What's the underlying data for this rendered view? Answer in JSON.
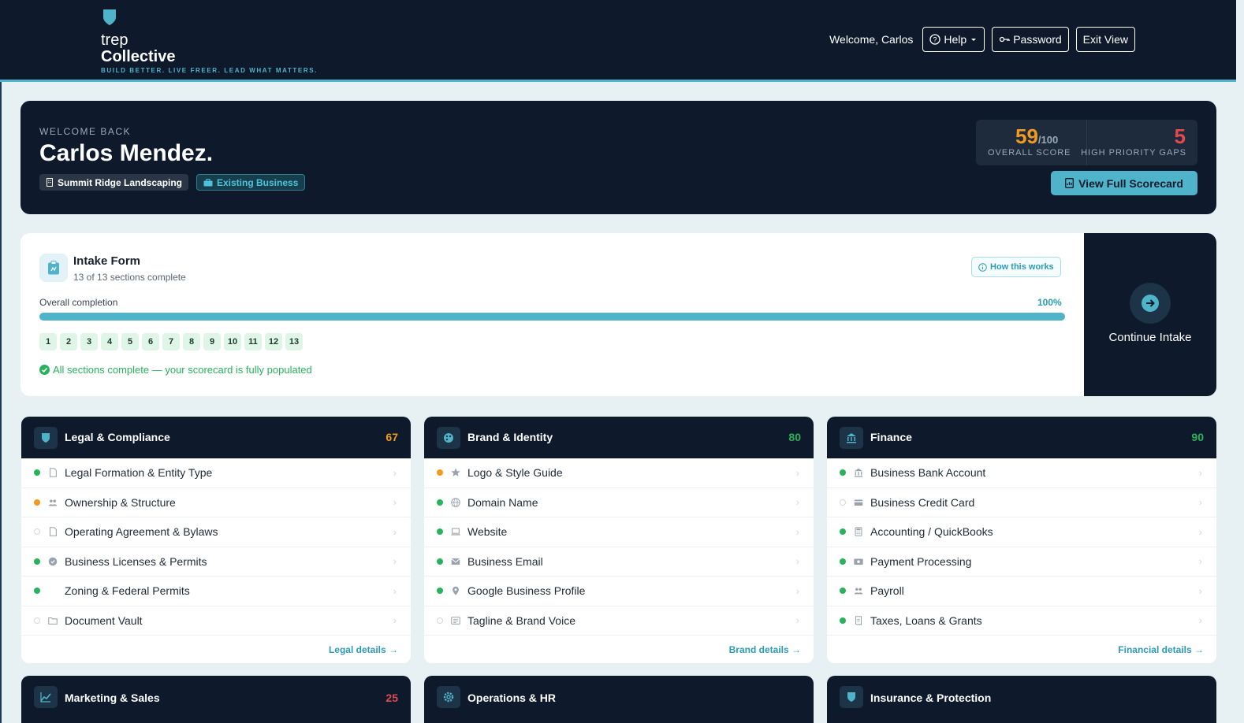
{
  "brand": {
    "line1": "trep",
    "line2": "Collective",
    "tagline": "BUILD BETTER. LIVE FREER. LEAD WHAT MATTERS."
  },
  "nav": {
    "welcome": "Welcome, Carlos",
    "help": "Help",
    "password": "Password",
    "exit": "Exit View"
  },
  "hero": {
    "kicker": "WELCOME BACK",
    "name": "Carlos Mendez.",
    "company": "Summit Ridge Landscaping",
    "stage": "Existing Business",
    "score": "59",
    "score_max": "/100",
    "score_label": "OVERALL SCORE",
    "gaps": "5",
    "gaps_label": "HIGH PRIORITY GAPS",
    "scorecard_button": "View Full Scorecard"
  },
  "intake": {
    "title": "Intake Form",
    "subtitle": "13 of 13 sections complete",
    "how": "How this works",
    "completion_label": "Overall completion",
    "completion_pct": "100%",
    "completion_value": 1.0,
    "steps": [
      "1",
      "2",
      "3",
      "4",
      "5",
      "6",
      "7",
      "8",
      "9",
      "10",
      "11",
      "12",
      "13"
    ],
    "done_message": "All sections complete — your scorecard is fully populated",
    "continue": "Continue Intake"
  },
  "colors": {
    "green": "#27b35c",
    "orange": "#f29a1f",
    "red": "#e5484d",
    "gray": "#d3d8de",
    "accent": "#4fb3c9",
    "navy": "#0e1a2b"
  },
  "cards": [
    {
      "title": "Legal & Compliance",
      "score": "67",
      "score_color": "#f29a1f",
      "icon": "shield-icon",
      "footer": "Legal details →",
      "items": [
        {
          "label": "Legal Formation & Entity Type",
          "status": "green",
          "icon": "document-icon"
        },
        {
          "label": "Ownership & Structure",
          "status": "orange",
          "icon": "people-icon"
        },
        {
          "label": "Operating Agreement & Bylaws",
          "status": "gray",
          "icon": "document-icon"
        },
        {
          "label": "Business Licenses & Permits",
          "status": "green",
          "icon": "badge-icon"
        },
        {
          "label": "Zoning & Federal Permits",
          "status": "green",
          "icon": ""
        },
        {
          "label": "Document Vault",
          "status": "gray",
          "icon": "folder-icon"
        }
      ]
    },
    {
      "title": "Brand & Identity",
      "score": "80",
      "score_color": "#27b35c",
      "icon": "palette-icon",
      "footer": "Brand details →",
      "items": [
        {
          "label": "Logo & Style Guide",
          "status": "orange",
          "icon": "star-icon"
        },
        {
          "label": "Domain Name",
          "status": "green",
          "icon": "globe-icon"
        },
        {
          "label": "Website",
          "status": "green",
          "icon": "laptop-icon"
        },
        {
          "label": "Business Email",
          "status": "green",
          "icon": "mail-icon"
        },
        {
          "label": "Google Business Profile",
          "status": "green",
          "icon": "pin-icon"
        },
        {
          "label": "Tagline & Brand Voice",
          "status": "gray",
          "icon": "text-icon"
        }
      ]
    },
    {
      "title": "Finance",
      "score": "90",
      "score_color": "#27b35c",
      "icon": "bank-icon",
      "footer": "Financial details →",
      "items": [
        {
          "label": "Business Bank Account",
          "status": "green",
          "icon": "bank-icon"
        },
        {
          "label": "Business Credit Card",
          "status": "gray",
          "icon": "card-icon"
        },
        {
          "label": "Accounting / QuickBooks",
          "status": "green",
          "icon": "calculator-icon"
        },
        {
          "label": "Payment Processing",
          "status": "green",
          "icon": "cash-icon"
        },
        {
          "label": "Payroll",
          "status": "green",
          "icon": "people-icon"
        },
        {
          "label": "Taxes, Loans & Grants",
          "status": "green",
          "icon": "receipt-icon"
        }
      ]
    }
  ],
  "cards_row2": [
    {
      "title": "Marketing & Sales",
      "score": "25",
      "score_color": "#e5484d",
      "icon": "chart-icon"
    },
    {
      "title": "Operations & HR",
      "score": "",
      "score_color": "#27b35c",
      "icon": "gear-icon"
    },
    {
      "title": "Insurance & Protection",
      "score": "",
      "score_color": "#27b35c",
      "icon": "shield-icon"
    }
  ]
}
